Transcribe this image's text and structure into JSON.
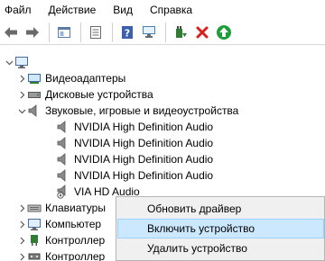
{
  "menu": {
    "items": [
      "Файл",
      "Действие",
      "Вид",
      "Справка"
    ]
  },
  "toolbar": {
    "buttons": [
      "back-icon",
      "forward-icon",
      "properties-icon",
      "console-icon",
      "help-icon",
      "scan-icon",
      "update-driver-icon",
      "uninstall-icon",
      "enable-icon"
    ]
  },
  "tree": {
    "items": [
      {
        "label": "Видеоадаптеры"
      },
      {
        "label": "Дисковые устройства"
      },
      {
        "label": "Звуковые, игровые и видеоустройства"
      },
      {
        "label": "NVIDIA High Definition Audio"
      },
      {
        "label": "NVIDIA High Definition Audio"
      },
      {
        "label": "NVIDIA High Definition Audio"
      },
      {
        "label": "NVIDIA High Definition Audio"
      },
      {
        "label": "VIA HD Audio"
      },
      {
        "label": "Клавиатуры"
      },
      {
        "label": "Компьютер"
      },
      {
        "label": "Контроллер"
      },
      {
        "label": "Контроллер"
      }
    ]
  },
  "context_menu": {
    "items": [
      {
        "label": "Обновить драйвер"
      },
      {
        "label": "Включить устройство"
      },
      {
        "label": "Удалить устройство"
      }
    ]
  },
  "colors": {
    "highlight": "#cce8ff",
    "highlight_border": "#99d1ff",
    "menu_bg": "#f0f0f0"
  }
}
